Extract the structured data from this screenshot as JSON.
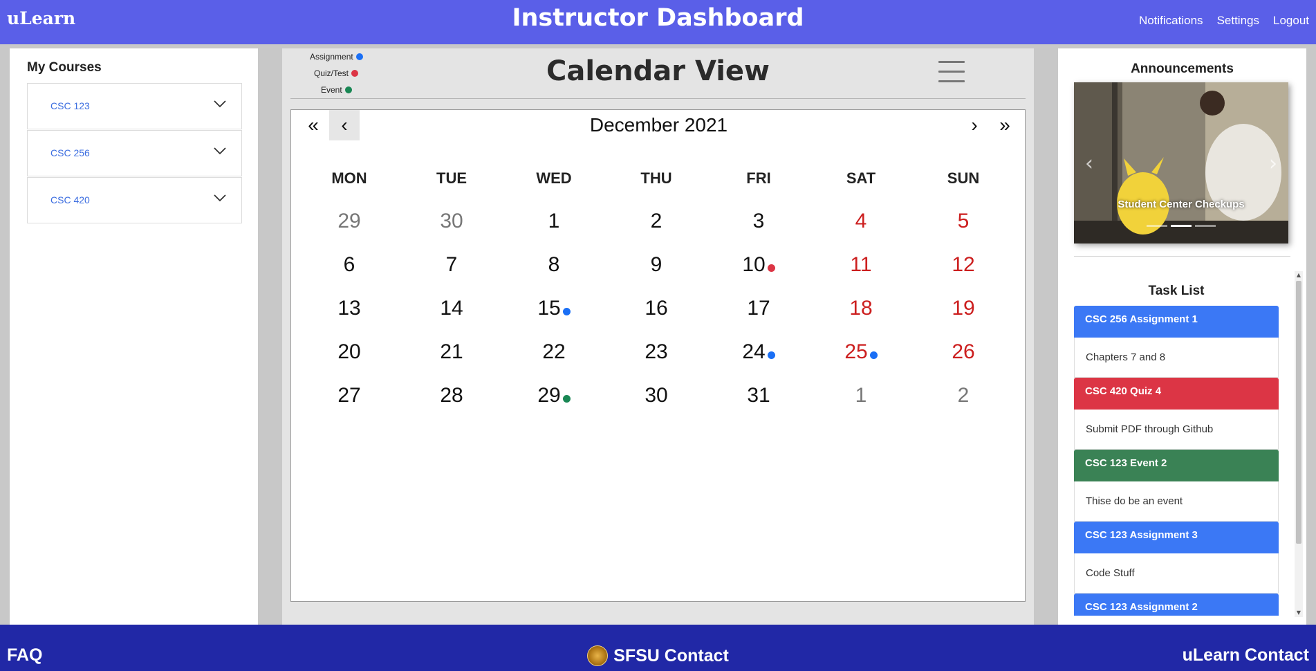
{
  "header": {
    "logo": "uLearn",
    "title": "Instructor Dashboard",
    "nav": [
      "Notifications",
      "Settings",
      "Logout"
    ]
  },
  "sidebar": {
    "heading": "My Courses",
    "courses": [
      "CSC 123",
      "CSC 256",
      "CSC 420"
    ]
  },
  "calendar": {
    "title": "Calendar View",
    "legend": [
      {
        "label": "Assignment",
        "color": "#1a6ff5"
      },
      {
        "label": "Quiz/Test",
        "color": "#dc3545"
      },
      {
        "label": "Event",
        "color": "#198754"
      }
    ],
    "nav": {
      "first": "«",
      "prev": "‹",
      "next": "›",
      "last": "»"
    },
    "month": "December 2021",
    "weekdays": [
      "MON",
      "TUE",
      "WED",
      "THU",
      "FRI",
      "SAT",
      "SUN"
    ],
    "weeks": [
      [
        "29",
        "30",
        "1",
        "2",
        "3",
        "4",
        "5"
      ],
      [
        "6",
        "7",
        "8",
        "9",
        "10",
        "11",
        "12"
      ],
      [
        "13",
        "14",
        "15",
        "16",
        "17",
        "18",
        "19"
      ],
      [
        "20",
        "21",
        "22",
        "23",
        "24",
        "25",
        "26"
      ],
      [
        "27",
        "28",
        "29",
        "30",
        "31",
        "1",
        "2"
      ]
    ],
    "markers": {
      "1-4": "#dc3545",
      "2-2": "#1a6ff5",
      "3-4": "#1a6ff5",
      "3-5": "#1a6ff5",
      "4-2": "#198754"
    }
  },
  "announcements": {
    "title": "Announcements",
    "caption": "Student Center Checkups",
    "prev": "‹",
    "next": "›"
  },
  "tasks": {
    "title": "Task List",
    "items": [
      {
        "title": "CSC 256 Assignment 1",
        "desc": "Chapters 7 and 8",
        "color": "#3b78f5"
      },
      {
        "title": "CSC 420 Quiz 4",
        "desc": "Submit PDF through Github",
        "color": "#dc3545"
      },
      {
        "title": "CSC 123 Event 2",
        "desc": "Thise do be an event",
        "color": "#3a8255"
      },
      {
        "title": "CSC 123 Assignment 3",
        "desc": "Code Stuff",
        "color": "#3b78f5"
      },
      {
        "title": "CSC 123 Assignment 2",
        "desc": "",
        "color": "#3b78f5"
      }
    ]
  },
  "footer": {
    "faq": "FAQ",
    "sfsu": "SFSU Contact",
    "ulearn": "uLearn Contact"
  }
}
